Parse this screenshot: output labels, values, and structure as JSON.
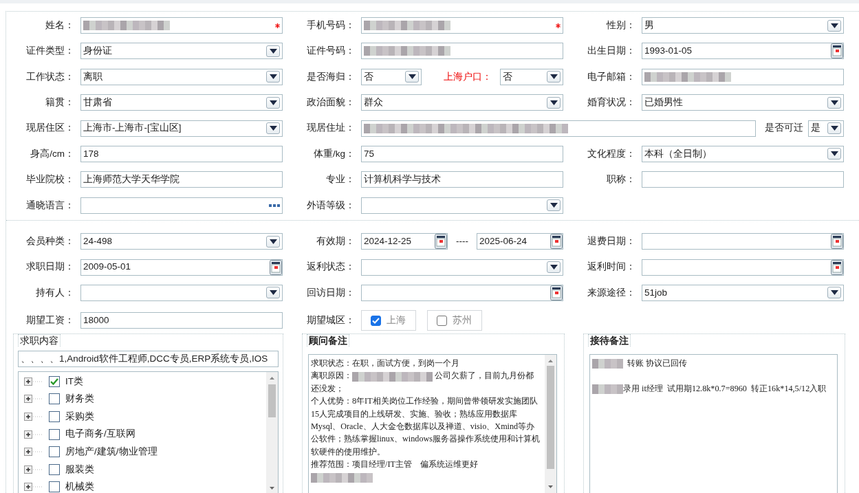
{
  "sections": [
    {
      "rows": [
        [
          {
            "label": "姓名：",
            "kind": "text",
            "redacted": true,
            "required": true
          },
          {
            "label": "手机号码：",
            "kind": "text",
            "redacted": true,
            "required": true
          },
          {
            "label": "性别：",
            "kind": "select",
            "value": "男"
          }
        ],
        [
          {
            "label": "证件类型：",
            "kind": "select",
            "value": "身份证"
          },
          {
            "label": "证件号码：",
            "kind": "text",
            "redacted": true
          },
          {
            "label": "出生日期：",
            "kind": "date",
            "value": "1993-01-05"
          }
        ],
        [
          {
            "label": "工作状态：",
            "kind": "select",
            "value": "离职"
          },
          {
            "label": "是否海归：",
            "kind": "select",
            "value": "否",
            "extra": {
              "label": "上海户口：",
              "emphasis": true,
              "kind": "select",
              "value": "否"
            }
          },
          {
            "label": "电子邮箱：",
            "kind": "text",
            "redacted": true
          }
        ],
        [
          {
            "label": "籍贯：",
            "kind": "select",
            "value": "甘肃省"
          },
          {
            "label": "政治面貌：",
            "kind": "select",
            "value": "群众"
          },
          {
            "label": "婚育状况：",
            "kind": "select",
            "value": "已婚男性"
          }
        ],
        [
          {
            "label": "现居住区：",
            "kind": "select",
            "value": "上海市-上海市-[宝山区]"
          },
          {
            "label": "现居住址：",
            "kind": "text",
            "redacted": true,
            "wide": true,
            "extra": {
              "label": "是否可迁",
              "emphasis": false,
              "kind": "select",
              "value": "是"
            }
          }
        ],
        [
          {
            "label": "身高/cm：",
            "kind": "text",
            "value": "178"
          },
          {
            "label": "体重/kg：",
            "kind": "text",
            "value": "75"
          },
          {
            "label": "文化程度：",
            "kind": "select",
            "value": "本科（全日制）"
          }
        ],
        [
          {
            "label": "毕业院校：",
            "kind": "text",
            "value": "上海师范大学天华学院"
          },
          {
            "label": "专业：",
            "kind": "text",
            "value": "计算机科学与技术"
          },
          {
            "label": "职称：",
            "kind": "text"
          }
        ],
        [
          {
            "label": "通晓语言：",
            "kind": "lookup"
          },
          {
            "label": "外语等级：",
            "kind": "select"
          }
        ]
      ]
    },
    {
      "rows": [
        [
          {
            "label": "会员种类：",
            "kind": "select",
            "value": "24-498"
          },
          {
            "label": "有效期：",
            "kind": "range",
            "values": [
              "2024-12-25",
              "2025-06-24"
            ],
            "separator": "----"
          },
          {
            "label": "退费日期：",
            "kind": "date"
          }
        ],
        [
          {
            "label": "求职日期：",
            "kind": "date",
            "value": "2009-05-01"
          },
          {
            "label": "返利状态：",
            "kind": "select"
          },
          {
            "label": "返利时间：",
            "kind": "date"
          }
        ],
        [
          {
            "label": "持有人：",
            "kind": "select"
          },
          {
            "label": "回访日期：",
            "kind": "date"
          },
          {
            "label": "来源途径：",
            "kind": "select",
            "value": "51job"
          }
        ],
        [
          {
            "label": "期望工资：",
            "kind": "text",
            "value": "18000"
          },
          {
            "label": "期望城区：",
            "kind": "options",
            "options": [
              {
                "label": "上海",
                "checked": true
              },
              {
                "label": "苏州",
                "checked": false
              }
            ]
          }
        ]
      ]
    }
  ],
  "panels": [
    {
      "title": "求职内容",
      "kind": "tree",
      "summary": "、、、、1,Android软件工程师,DCC专员,ERP系统专员,IOS",
      "items": [
        {
          "label": "IT类",
          "checked": true,
          "expanded": false
        },
        {
          "label": "财务类",
          "checked": false,
          "expanded": false
        },
        {
          "label": "采购类",
          "checked": false,
          "expanded": false
        },
        {
          "label": "电子商务/互联网",
          "checked": false,
          "expanded": false
        },
        {
          "label": "房地产/建筑/物业管理",
          "checked": false,
          "expanded": false
        },
        {
          "label": "服装类",
          "checked": false,
          "expanded": false
        },
        {
          "label": "机械类",
          "checked": false,
          "expanded": false
        }
      ]
    },
    {
      "title": "顾问备注",
      "kind": "notes",
      "scrollable": true,
      "paragraphs": [
        {
          "segments": [
            {
              "kind": "text",
              "text": "求职状态：在职，面试方便，到岗一个月"
            }
          ]
        },
        {
          "segments": [
            {
              "kind": "text",
              "text": "离职原因："
            },
            {
              "kind": "redacted"
            },
            {
              "kind": "text",
              "text": " 公司欠薪了，目前九月份都还没发；"
            }
          ]
        },
        {
          "segments": [
            {
              "kind": "text",
              "text": "个人优势：8年IT相关岗位工作经验，期间曾带领研发实施团队15人完成项目的上线研发、实施、验收；熟练应用数据库Mysql、Oracle、人大金仓数据库以及禅道、visio、Xmind等办公软件；熟练掌握linux、windows服务器操作系统使用和计算机软硬件的使用维护。"
            }
          ]
        },
        {
          "segments": [
            {
              "kind": "text",
              "text": "推荐范围：项目经理/IT主管    偏系统运维更好"
            }
          ]
        },
        {
          "segments": [
            {
              "kind": "redacted"
            }
          ]
        }
      ]
    },
    {
      "title": "接待备注",
      "kind": "notes",
      "scrollable": false,
      "paragraphs": [
        {
          "segments": [
            {
              "kind": "redacted"
            },
            {
              "kind": "text",
              "text": "  转账 协议已回传"
            }
          ],
          "blank_line_after": true
        },
        {
          "segments": [
            {
              "kind": "redacted"
            },
            {
              "kind": "text",
              "text": "录用 it经理  试用期12.8k*0.7=8960  转正16k*14,5/12入职"
            }
          ]
        }
      ]
    }
  ]
}
